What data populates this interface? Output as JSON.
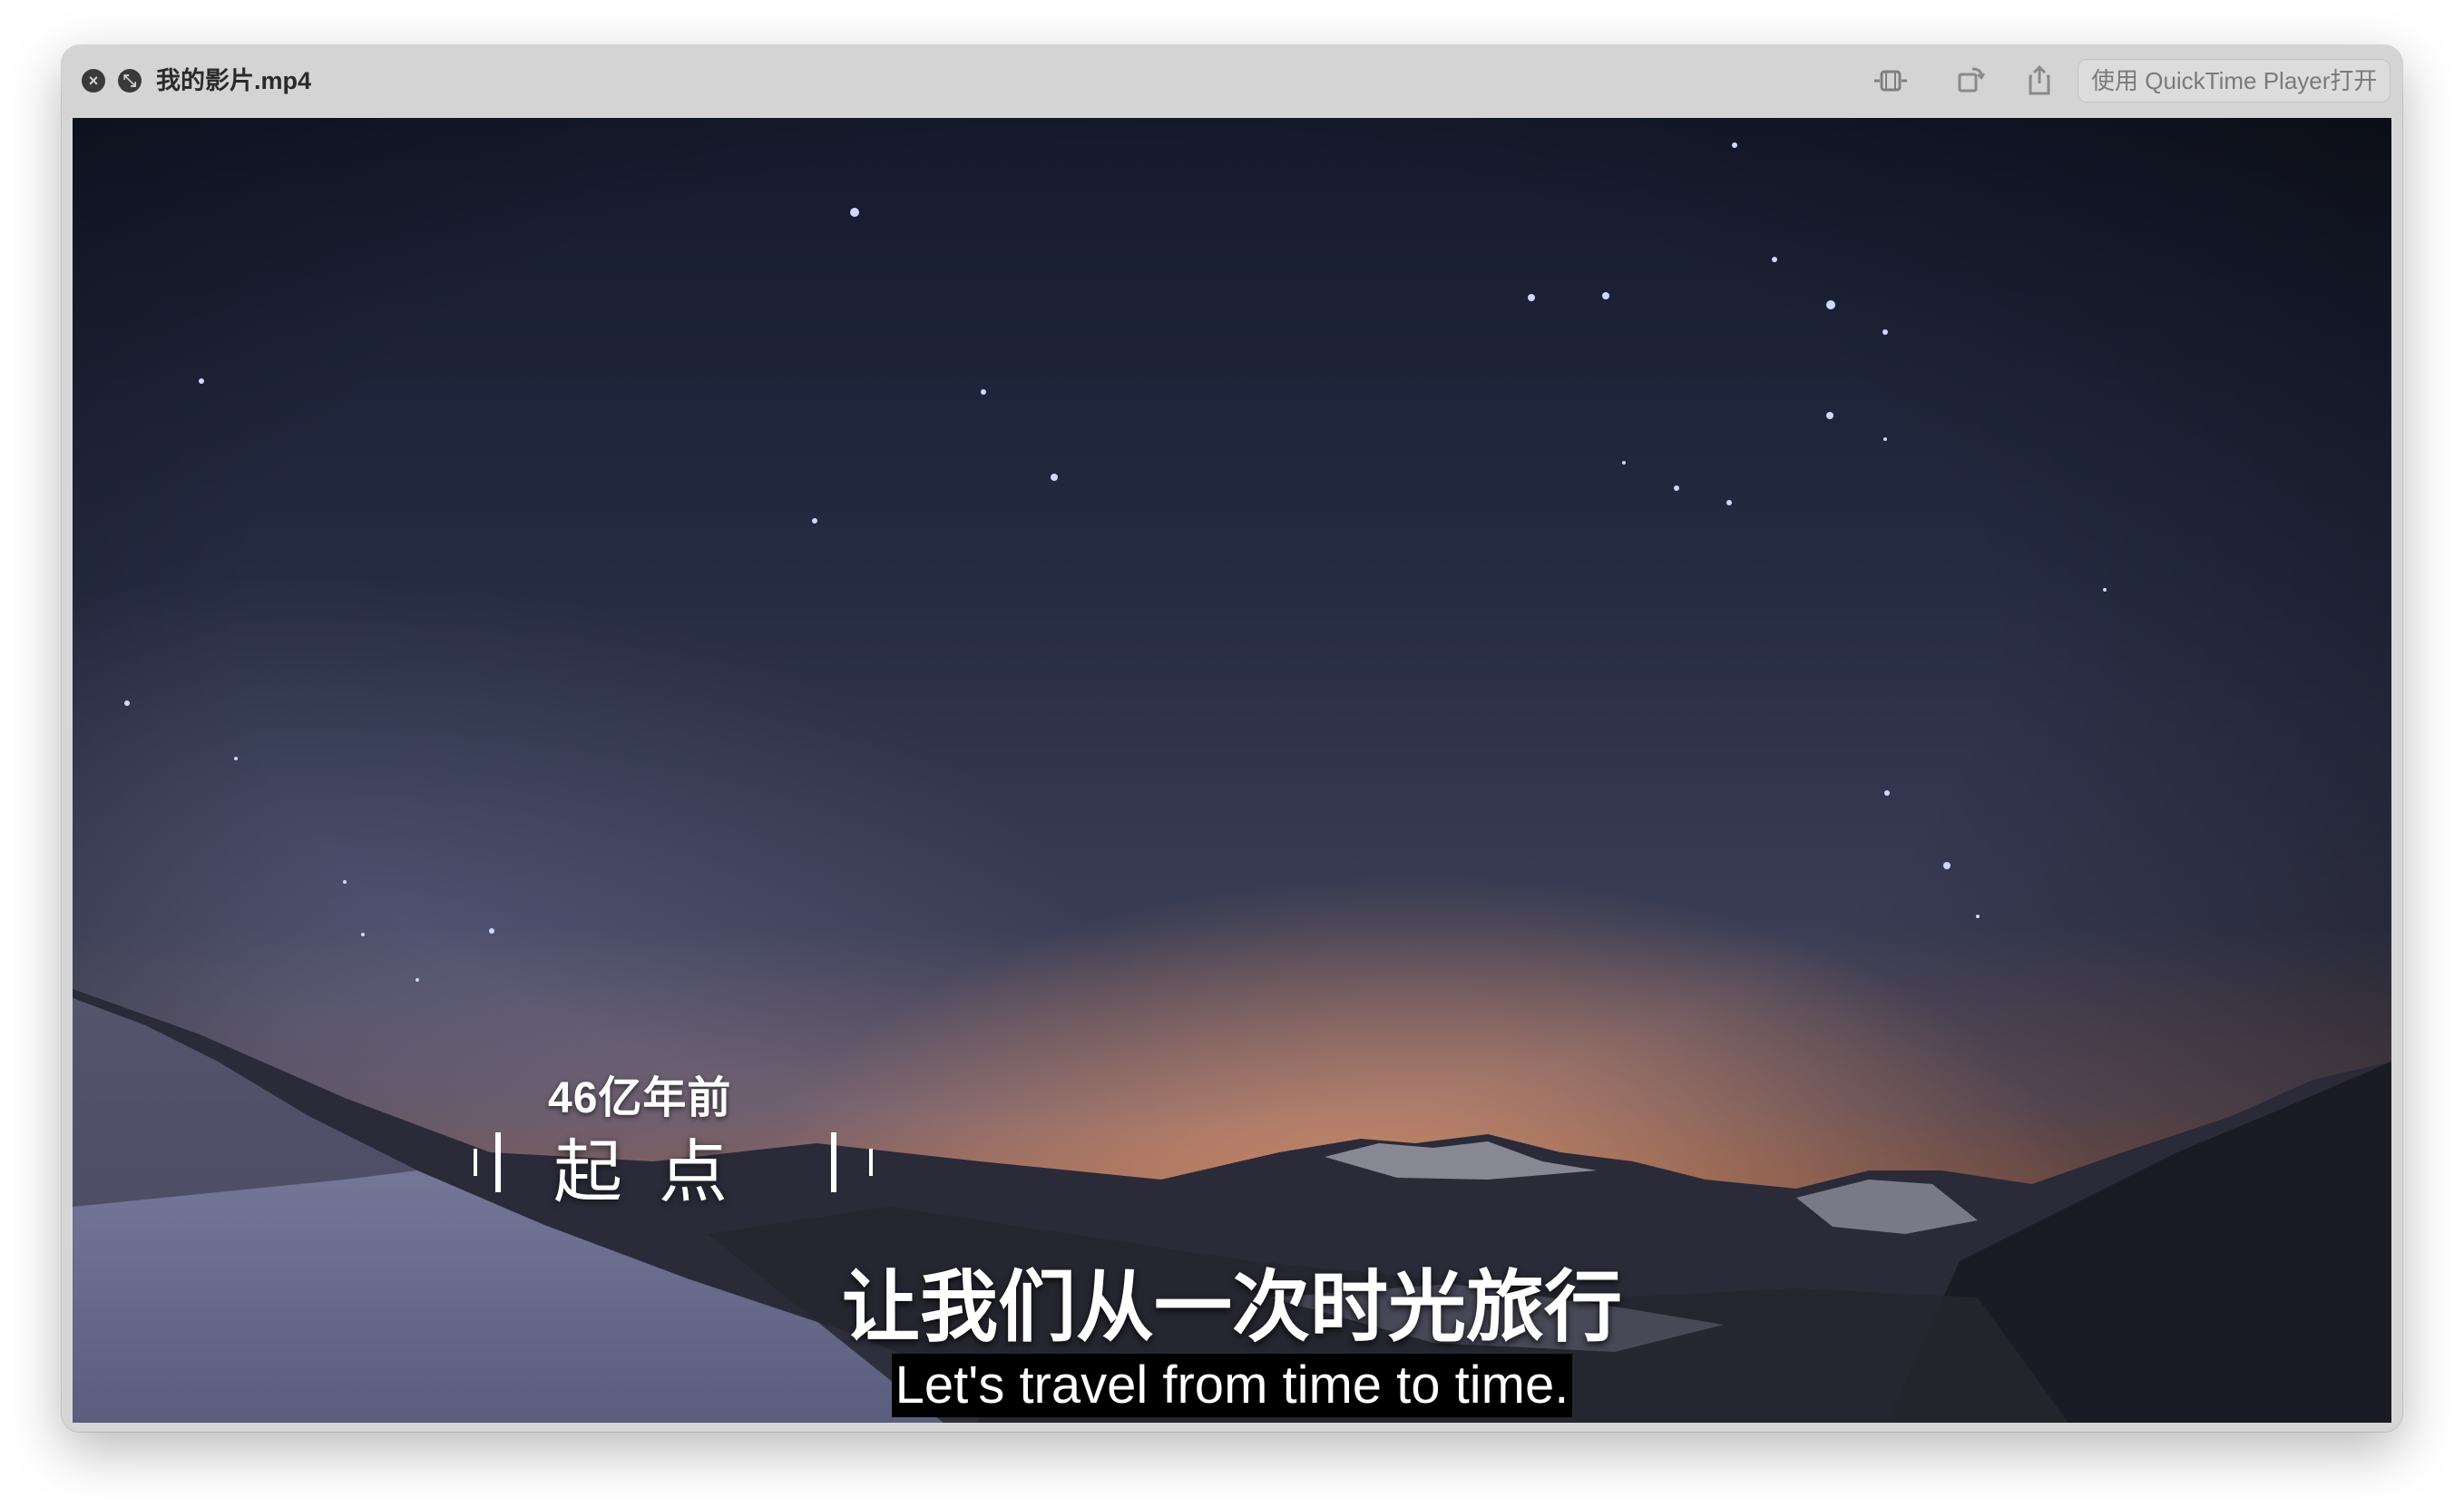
{
  "window": {
    "title": "我的影片.mp4",
    "open_button_label": "使用 QuickTime Player打开"
  },
  "icons": {
    "close": "close-icon",
    "minimize": "minimize-icon",
    "trim": "trim-icon",
    "rotate": "rotate-icon",
    "share": "share-icon"
  },
  "video": {
    "chapter_date": "46亿年前",
    "chapter_name": "起点",
    "subtitle_cn": "让我们从一次时光旅行",
    "subtitle_en": "Let's travel from time to time."
  },
  "colors": {
    "titlebar": "#d4d4d4",
    "sky_top": "#1a2036",
    "horizon_glow": "#c77a52"
  }
}
